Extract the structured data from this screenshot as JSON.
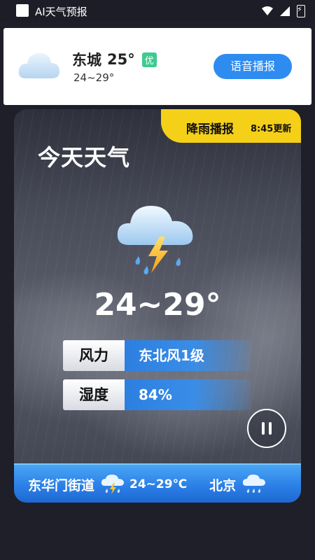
{
  "status_bar": {
    "app_title": "AI天气预报"
  },
  "top_card": {
    "city": "东城",
    "temp": "25°",
    "aqi_label": "优",
    "range": "24~29°",
    "voice_button_label": "语音播报"
  },
  "main_card": {
    "rain_badge_title": "降雨播报",
    "rain_badge_time": "8:45更新",
    "today_title": "今天天气",
    "temp_range": "24~29°",
    "wind_label": "风力",
    "wind_value": "东北风1级",
    "humidity_label": "湿度",
    "humidity_value": "84%",
    "pause_icon": "pause-icon"
  },
  "ticker": [
    {
      "city": "东华门街道",
      "temp": "24~29℃",
      "icon": "thunder-shower-icon"
    },
    {
      "city": "北京",
      "temp": "",
      "icon": "rain-icon"
    }
  ],
  "colors": {
    "accent_blue": "#2e8cf0",
    "badge_yellow": "#f5d018",
    "aqi_green": "#3dcb8f"
  }
}
